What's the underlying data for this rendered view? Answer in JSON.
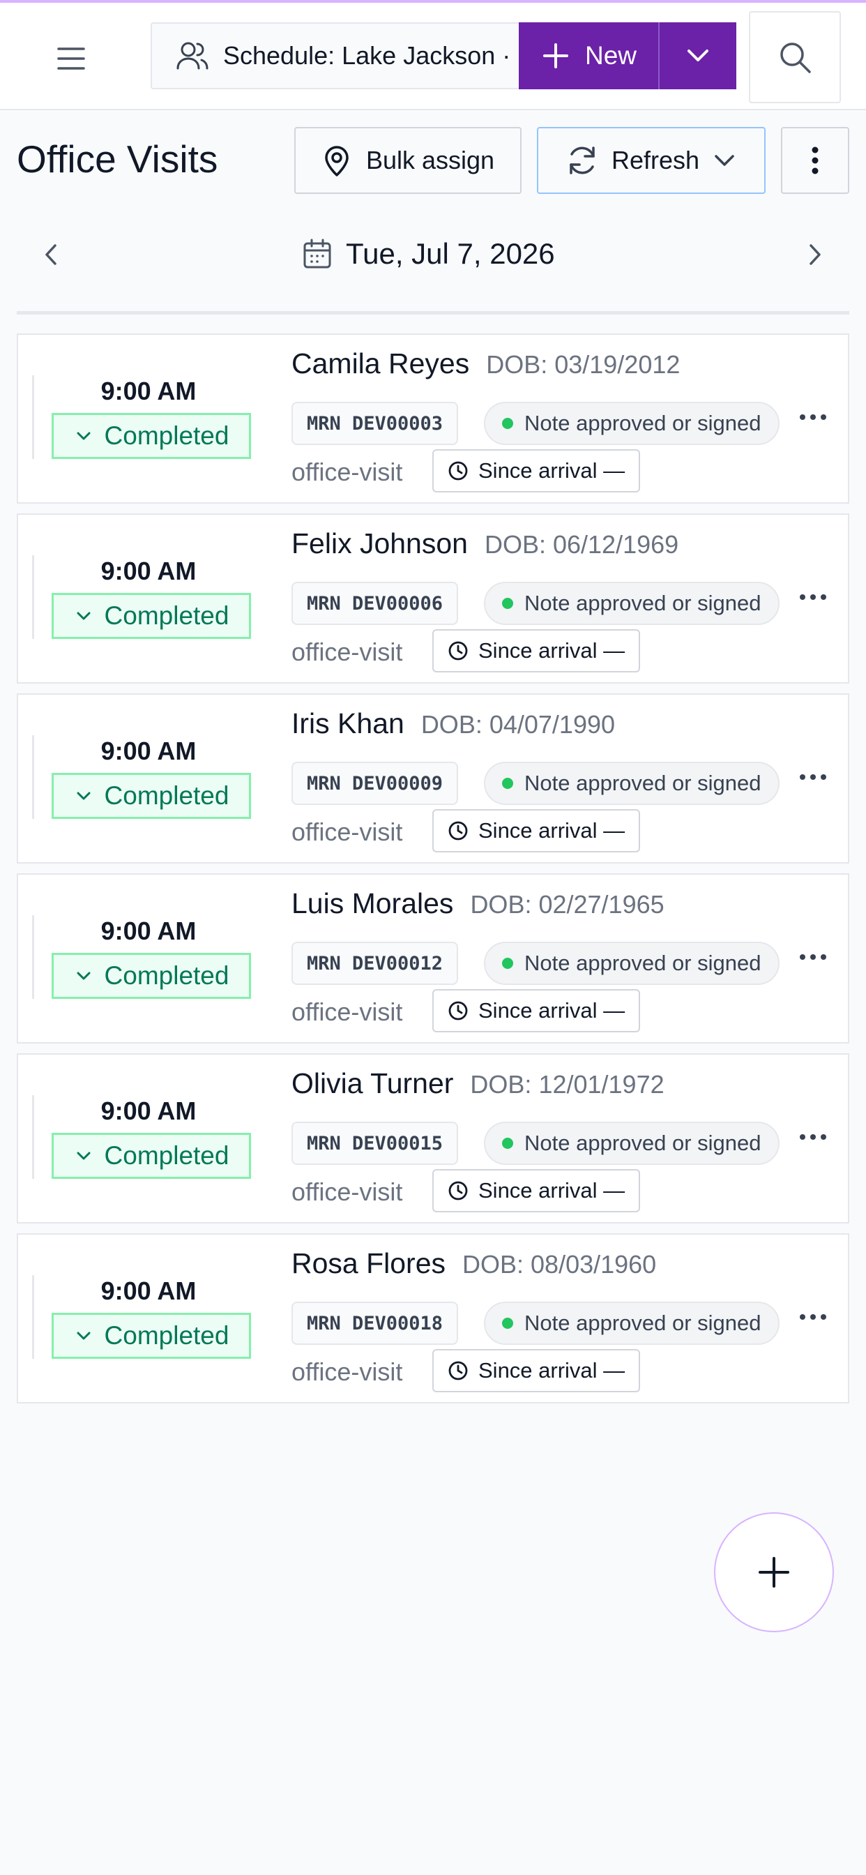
{
  "header": {
    "schedule_label": "Schedule: Lake Jackson ·",
    "new_label": "New"
  },
  "toolbar": {
    "title": "Office Visits",
    "bulk_assign_label": "Bulk assign",
    "refresh_label": "Refresh"
  },
  "date_nav": {
    "date": "Tue, Jul 7, 2026"
  },
  "visits": [
    {
      "time": "9:00 AM",
      "status": "Completed",
      "name": "Camila Reyes",
      "dob": "DOB: 03/19/2012",
      "mrn": "MRN DEV00003",
      "note": "Note approved or signed",
      "type": "office-visit",
      "since": "Since arrival —"
    },
    {
      "time": "9:00 AM",
      "status": "Completed",
      "name": "Felix Johnson",
      "dob": "DOB: 06/12/1969",
      "mrn": "MRN DEV00006",
      "note": "Note approved or signed",
      "type": "office-visit",
      "since": "Since arrival —"
    },
    {
      "time": "9:00 AM",
      "status": "Completed",
      "name": "Iris Khan",
      "dob": "DOB: 04/07/1990",
      "mrn": "MRN DEV00009",
      "note": "Note approved or signed",
      "type": "office-visit",
      "since": "Since arrival —"
    },
    {
      "time": "9:00 AM",
      "status": "Completed",
      "name": "Luis Morales",
      "dob": "DOB: 02/27/1965",
      "mrn": "MRN DEV00012",
      "note": "Note approved or signed",
      "type": "office-visit",
      "since": "Since arrival —"
    },
    {
      "time": "9:00 AM",
      "status": "Completed",
      "name": "Olivia Turner",
      "dob": "DOB: 12/01/1972",
      "mrn": "MRN DEV00015",
      "note": "Note approved or signed",
      "type": "office-visit",
      "since": "Since arrival —"
    },
    {
      "time": "9:00 AM",
      "status": "Completed",
      "name": "Rosa Flores",
      "dob": "DOB: 08/03/1960",
      "mrn": "MRN DEV00018",
      "note": "Note approved or signed",
      "type": "office-visit",
      "since": "Since arrival —"
    }
  ],
  "colors": {
    "brand": "#6b21a8",
    "status_green": "#047857",
    "status_bg": "#ecfdf5",
    "note_dot": "#22c55e"
  },
  "icons": {
    "menu": "hamburger-icon",
    "users": "users-icon",
    "add": "plus-icon",
    "expand": "chevron-down-icon",
    "search": "search-icon",
    "location": "map-pin-icon",
    "refresh": "refresh-icon",
    "more": "more-vertical-icon",
    "prev": "chevron-left-icon",
    "next": "chevron-right-icon",
    "calendar": "calendar-icon",
    "clock": "clock-icon",
    "row_menu": "more-horizontal-icon"
  }
}
